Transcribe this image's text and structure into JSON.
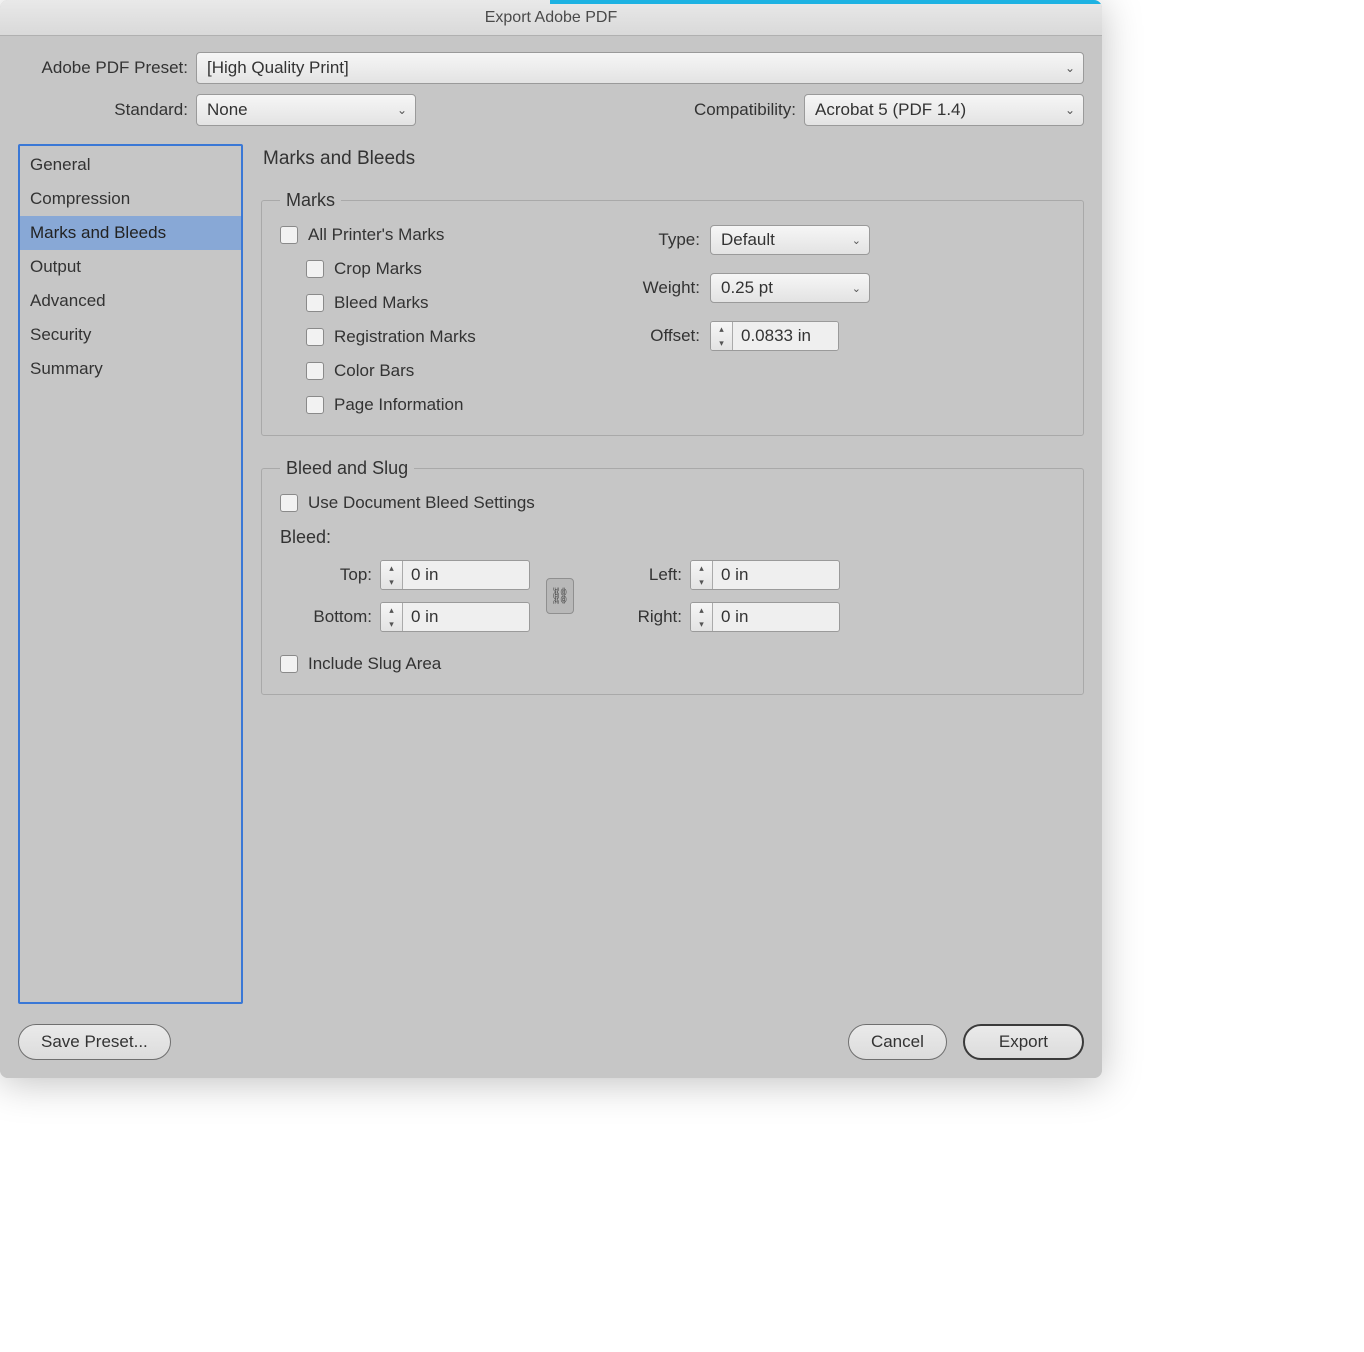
{
  "title": "Export Adobe PDF",
  "preset": {
    "label": "Adobe PDF Preset:",
    "value": "[High Quality Print]"
  },
  "standard": {
    "label": "Standard:",
    "value": "None"
  },
  "compat": {
    "label": "Compatibility:",
    "value": "Acrobat 5 (PDF 1.4)"
  },
  "sidebar": [
    {
      "label": "General"
    },
    {
      "label": "Compression"
    },
    {
      "label": "Marks and Bleeds"
    },
    {
      "label": "Output"
    },
    {
      "label": "Advanced"
    },
    {
      "label": "Security"
    },
    {
      "label": "Summary"
    }
  ],
  "panel_title": "Marks and Bleeds",
  "marks": {
    "legend": "Marks",
    "all": "All Printer's Marks",
    "crop": "Crop Marks",
    "bleed": "Bleed Marks",
    "reg": "Registration Marks",
    "color": "Color Bars",
    "page": "Page Information",
    "type_label": "Type:",
    "type_value": "Default",
    "weight_label": "Weight:",
    "weight_value": "0.25 pt",
    "offset_label": "Offset:",
    "offset_value": "0.0833 in"
  },
  "bleed": {
    "legend": "Bleed and Slug",
    "use_doc": "Use Document Bleed Settings",
    "bleed_label": "Bleed:",
    "top_label": "Top:",
    "top_value": "0 in",
    "bottom_label": "Bottom:",
    "bottom_value": "0 in",
    "left_label": "Left:",
    "left_value": "0 in",
    "right_label": "Right:",
    "right_value": "0 in",
    "slug": "Include Slug Area"
  },
  "buttons": {
    "save_preset": "Save Preset...",
    "cancel": "Cancel",
    "export": "Export"
  }
}
